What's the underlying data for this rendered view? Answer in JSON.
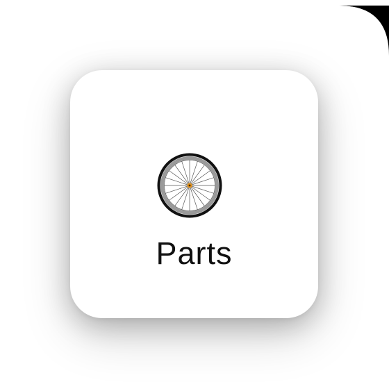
{
  "tile": {
    "label": "Parts",
    "icon": "bicycle-wheel-icon",
    "hub_color": "#e0901a",
    "rim_color": "#111111",
    "rim_inner_color": "#9a9a9a"
  }
}
